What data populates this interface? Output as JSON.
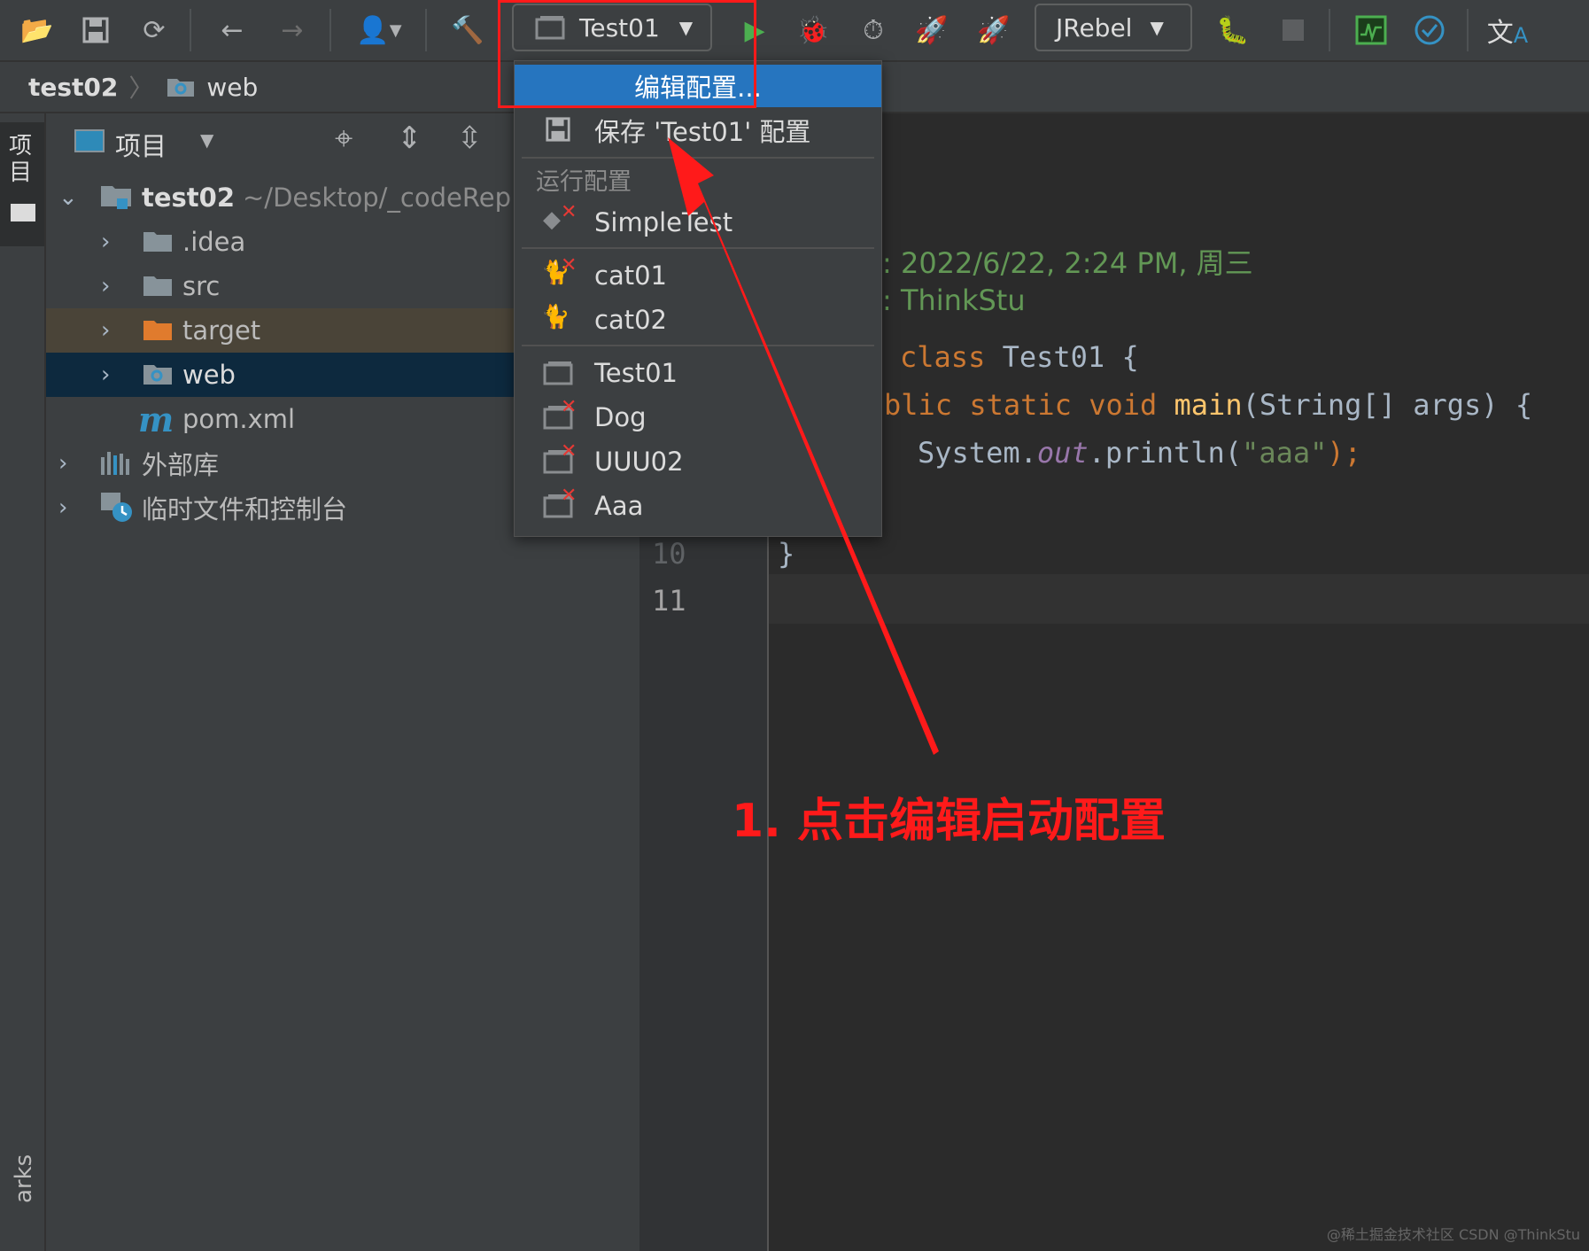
{
  "toolbar": {
    "run_config_selected": "Test01",
    "jrebel_label": "JRebel",
    "icons": [
      "open-folder-icon",
      "save-icon",
      "sync-icon",
      "back-arrow-icon",
      "forward-arrow-icon",
      "user-icon",
      "hammer-icon",
      "run-icon",
      "debug-icon",
      "profile-icon",
      "jrebel-run-icon",
      "jrebel-debug-icon",
      "attach-icon",
      "stop-icon",
      "monitor-icon",
      "check-icon",
      "translate-icon"
    ]
  },
  "breadcrumb": {
    "project": "test02",
    "folder": "web"
  },
  "left_stripe": {
    "project_tab": "项目",
    "bookmarks_tab": "arks"
  },
  "project_panel": {
    "view_label": "项目",
    "tree": [
      {
        "label": "test02",
        "path": "~/Desktop/_codeRep"
      },
      {
        "label": ".idea"
      },
      {
        "label": "src"
      },
      {
        "label": "target"
      },
      {
        "label": "web"
      },
      {
        "label": "pom.xml"
      },
      {
        "label": "外部库"
      },
      {
        "label": "临时文件和控制台"
      }
    ]
  },
  "popup": {
    "edit_config": "编辑配置...",
    "save_config": "保存 'Test01' 配置",
    "section_title": "运行配置",
    "items": [
      "SimpleTest",
      "cat01",
      "cat02",
      "Test01",
      "Dog",
      "UUU02",
      "Aaa"
    ]
  },
  "editor": {
    "comment_date": ": 2022/6/22, 2:24 PM, 周三",
    "comment_author": ": ThinkStu",
    "line_numbers": [
      "10",
      "11"
    ],
    "code": {
      "class_kw": "class",
      "class_name": " Test01 {",
      "public_frag": "blic",
      "static_kw": " static",
      "void_kw": " void",
      "main_name": " main",
      "main_rest": "(String[] args) {",
      "println_pre": "System.",
      "out_field": "out",
      "println_mid": ".println(",
      "string_lit": "\"aaa\"",
      "println_end": ");",
      "close_brace": "}"
    }
  },
  "annotation": {
    "text": "1. 点击编辑启动配置"
  },
  "watermark": "@稀土掘金技术社区 CSDN @ThinkStu",
  "colors": {
    "highlight": "#2675bf",
    "annotation_red": "#ff1a1a",
    "green_comment": "#629755",
    "keyword": "#cc7832",
    "method": "#ffc66d",
    "string": "#6a8759",
    "field": "#9876aa"
  }
}
